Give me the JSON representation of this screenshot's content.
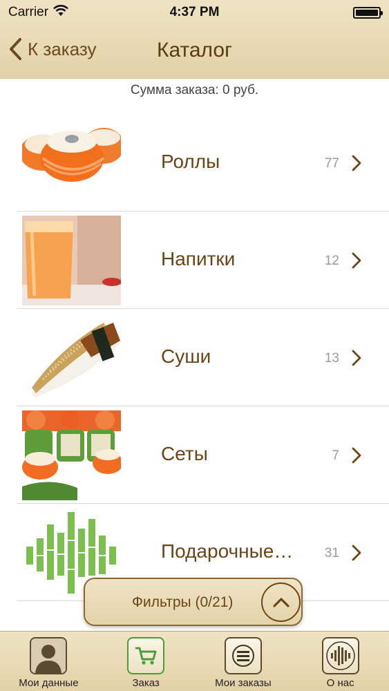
{
  "status_bar": {
    "carrier": "Carrier",
    "time": "4:37 PM"
  },
  "nav": {
    "back_label": "К заказу",
    "title": "Каталог"
  },
  "order_sum": "Сумма заказа: 0 руб.",
  "categories": [
    {
      "label": "Роллы",
      "count": "77",
      "image": "rolls-image"
    },
    {
      "label": "Напитки",
      "count": "12",
      "image": "drink-image"
    },
    {
      "label": "Суши",
      "count": "13",
      "image": "sushi-image"
    },
    {
      "label": "Сеты",
      "count": "7",
      "image": "sets-image"
    },
    {
      "label": "Подарочные…",
      "count": "31",
      "image": "gift-bamboo-image"
    }
  ],
  "filter": {
    "label": "Фильтры (0/21)"
  },
  "tabs": [
    {
      "label": "Мои данные",
      "icon": "person-icon"
    },
    {
      "label": "Заказ",
      "icon": "cart-icon",
      "active": true
    },
    {
      "label": "Мои заказы",
      "icon": "list-icon"
    },
    {
      "label": "О нас",
      "icon": "bamboo-logo-icon"
    }
  ],
  "colors": {
    "accent_brown": "#6b4416",
    "active_tab": "#4c9c3c",
    "parchment": "#e9dbb6"
  }
}
